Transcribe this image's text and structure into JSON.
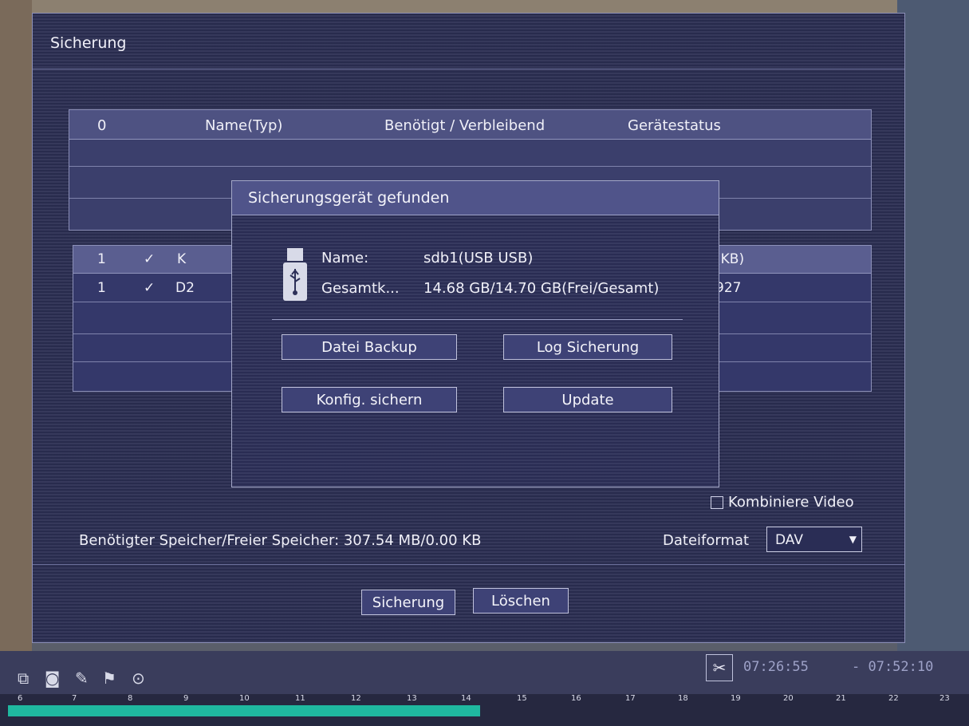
{
  "window": {
    "title": "Sicherung"
  },
  "device_table": {
    "headers": [
      "0",
      "Name(Typ)",
      "Benötigt / Verbleibend",
      "Gerätestatus"
    ]
  },
  "file_table": {
    "header_size": "(KB)",
    "rows": [
      {
        "num": "1",
        "check": "✓",
        "name": "K",
        "size": ""
      },
      {
        "num": "1",
        "check": "✓",
        "name": "D2",
        "size": "927"
      }
    ]
  },
  "combine_video_label": "Kombiniere Video",
  "storage_text": "Benötigter Speicher/Freier Speicher: 307.54 MB/0.00 KB",
  "file_format": {
    "label": "Dateiformat",
    "value": "DAV"
  },
  "footer": {
    "backup_button": "Sicherung",
    "delete_button": "Löschen"
  },
  "dialog": {
    "title": "Sicherungsgerät gefunden",
    "name_label": "Name:",
    "name_value": "sdb1(USB USB)",
    "capacity_label": "Gesamtk...",
    "capacity_value": "14.68 GB/14.70 GB(Frei/Gesamt)",
    "buttons": {
      "file_backup": "Datei Backup",
      "log_backup": "Log Sicherung",
      "config_backup": "Konfig. sichern",
      "update": "Update"
    },
    "icon": "usb-drive-icon"
  },
  "timeline": {
    "start_time": "07:26:55",
    "end_time": "- 07:52:10",
    "ticks": [
      "6",
      "7",
      "8",
      "9",
      "10",
      "11",
      "12",
      "13",
      "14",
      "15",
      "16",
      "17",
      "18",
      "19",
      "20",
      "21",
      "22",
      "23"
    ]
  },
  "colors": {
    "window_bg": "#2b2e52",
    "timeline_bar": "#1fb8a0"
  }
}
